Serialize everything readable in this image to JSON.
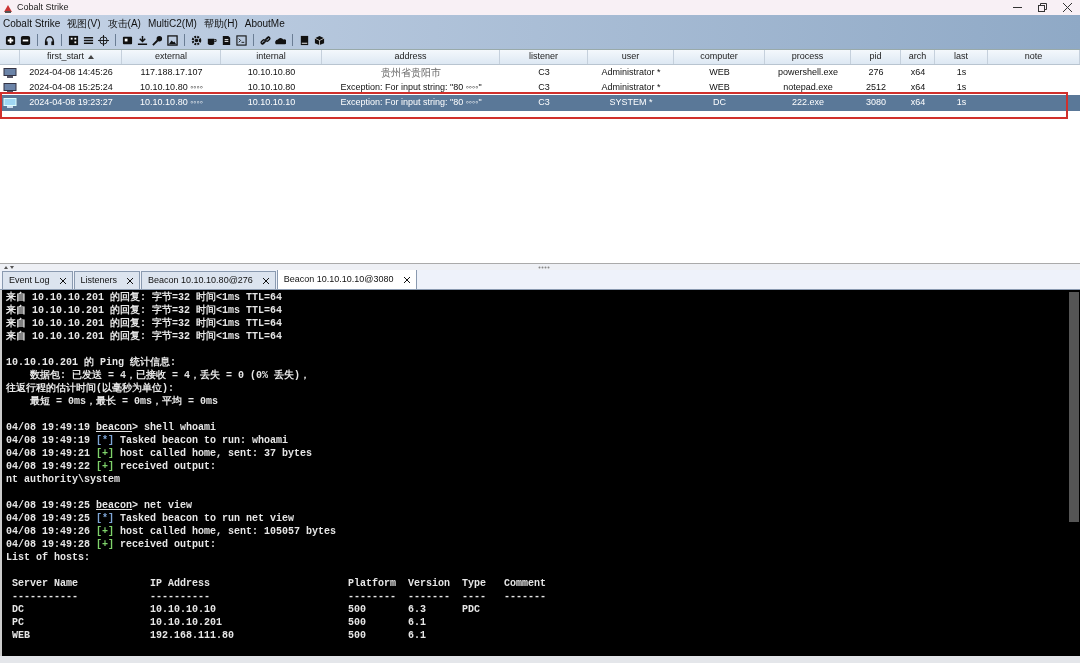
{
  "window": {
    "title": "Cobalt Strike"
  },
  "menu": [
    "Cobalt Strike",
    "视图(V)",
    "攻击(A)",
    "MultiC2(M)",
    "帮助(H)",
    "AboutMe"
  ],
  "table": {
    "columns": [
      {
        "label": "first_start",
        "sorted": true
      },
      {
        "label": "external",
        "sorted": false
      },
      {
        "label": "internal",
        "sorted": false
      },
      {
        "label": "address",
        "sorted": false
      },
      {
        "label": "listener",
        "sorted": false
      },
      {
        "label": "user",
        "sorted": false
      },
      {
        "label": "computer",
        "sorted": false
      },
      {
        "label": "process",
        "sorted": false
      },
      {
        "label": "pid",
        "sorted": false
      },
      {
        "label": "arch",
        "sorted": false
      },
      {
        "label": "last",
        "sorted": false
      },
      {
        "label": "note",
        "sorted": false
      }
    ],
    "rows": [
      {
        "selected": false,
        "highlighted": false,
        "cells": [
          "2024-04-08 14:45:26",
          "117.188.17.107",
          "10.10.10.80",
          "贵州省贵阳市",
          "C3",
          "Administrator *",
          "WEB",
          "powershell.exe",
          "276",
          "x64",
          "1s",
          ""
        ]
      },
      {
        "selected": false,
        "highlighted": false,
        "cells": [
          "2024-04-08 15:25:24",
          "10.10.10.80 ◦◦◦◦",
          "10.10.10.80",
          "Exception: For input string: \"80 ◦◦◦◦\"",
          "C3",
          "Administrator *",
          "WEB",
          "notepad.exe",
          "2512",
          "x64",
          "1s",
          ""
        ]
      },
      {
        "selected": true,
        "highlighted": true,
        "cells": [
          "2024-04-08 19:23:27",
          "10.10.10.80 ◦◦◦◦",
          "10.10.10.10",
          "Exception: For input string: \"80 ◦◦◦◦\"",
          "C3",
          "SYSTEM *",
          "DC",
          "222.exe",
          "3080",
          "x64",
          "1s",
          ""
        ]
      }
    ]
  },
  "tabs": [
    {
      "label": "Event Log",
      "selected": false
    },
    {
      "label": "Listeners",
      "selected": false
    },
    {
      "label": "Beacon 10.10.10.80@276",
      "selected": false
    },
    {
      "label": "Beacon 10.10.10.10@3080",
      "selected": true
    }
  ],
  "console": [
    {
      "kind": "text",
      "text": "来自 10.10.10.201 的回复: 字节=32 时间<1ms TTL=64"
    },
    {
      "kind": "text",
      "text": "来自 10.10.10.201 的回复: 字节=32 时间<1ms TTL=64"
    },
    {
      "kind": "text",
      "text": "来自 10.10.10.201 的回复: 字节=32 时间<1ms TTL=64"
    },
    {
      "kind": "text",
      "text": "来自 10.10.10.201 的回复: 字节=32 时间<1ms TTL=64"
    },
    {
      "kind": "blank"
    },
    {
      "kind": "text",
      "text": "10.10.10.201 的 Ping 统计信息:"
    },
    {
      "kind": "text",
      "text": "    数据包: 已发送 = 4，已接收 = 4，丢失 = 0 (0% 丢失)，"
    },
    {
      "kind": "text",
      "text": "往返行程的估计时间(以毫秒为单位):"
    },
    {
      "kind": "text",
      "text": "    最短 = 0ms，最长 = 0ms，平均 = 0ms"
    },
    {
      "kind": "blank"
    },
    {
      "kind": "prompt",
      "time": "04/08 19:49:19",
      "prompt": "beacon",
      "text": "> shell whoami"
    },
    {
      "kind": "task",
      "time": "04/08 19:49:19",
      "marker": "[*]",
      "text": "Tasked beacon to run: whoami"
    },
    {
      "kind": "ok",
      "time": "04/08 19:49:21",
      "marker": "[+]",
      "text": "host called home, sent: 37 bytes"
    },
    {
      "kind": "ok",
      "time": "04/08 19:49:22",
      "marker": "[+]",
      "text": "received output:"
    },
    {
      "kind": "text",
      "text": "nt authority\\system"
    },
    {
      "kind": "blank"
    },
    {
      "kind": "prompt",
      "time": "04/08 19:49:25",
      "prompt": "beacon",
      "text": "> net view"
    },
    {
      "kind": "task",
      "time": "04/08 19:49:25",
      "marker": "[*]",
      "text": "Tasked beacon to run net view"
    },
    {
      "kind": "ok",
      "time": "04/08 19:49:26",
      "marker": "[+]",
      "text": "host called home, sent: 105057 bytes"
    },
    {
      "kind": "ok",
      "time": "04/08 19:49:28",
      "marker": "[+]",
      "text": "received output:"
    },
    {
      "kind": "text",
      "text": "List of hosts:"
    },
    {
      "kind": "blank"
    },
    {
      "kind": "text",
      "text": " Server Name            IP Address                       Platform  Version  Type   Comment"
    },
    {
      "kind": "text",
      "text": " -----------            ----------                       --------  -------  ----   -------"
    },
    {
      "kind": "text",
      "text": " DC                     10.10.10.10                      500       6.3      PDC"
    },
    {
      "kind": "text",
      "text": " PC                     10.10.10.201                     500       6.1"
    },
    {
      "kind": "text",
      "text": " WEB                    192.168.111.80                   500       6.1"
    }
  ]
}
